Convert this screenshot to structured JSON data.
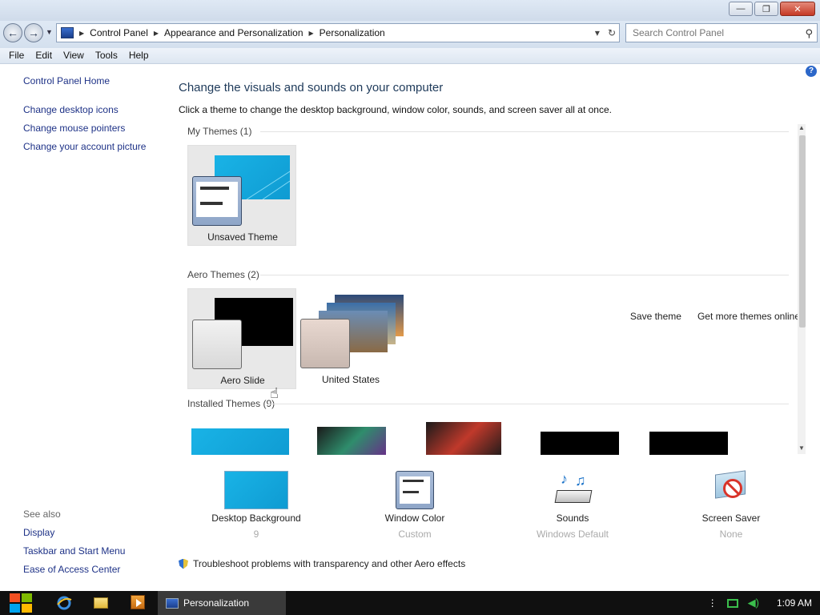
{
  "window": {
    "minimize_glyph": "—",
    "maximize_glyph": "❐",
    "close_glyph": "✕"
  },
  "nav": {
    "back_glyph": "←",
    "forward_glyph": "→",
    "dropdown_glyph": "▼",
    "breadcrumbs": [
      "Control Panel",
      "Appearance and Personalization",
      "Personalization"
    ],
    "refresh_glyph": "↻",
    "addr_dropdown_glyph": "▾",
    "search_placeholder": "Search Control Panel",
    "search_glyph": "⚲"
  },
  "menu": [
    "File",
    "Edit",
    "View",
    "Tools",
    "Help"
  ],
  "sidebar": {
    "home": "Control Panel Home",
    "links": [
      "Change desktop icons",
      "Change mouse pointers",
      "Change your account picture"
    ],
    "see_also": "See also",
    "see_also_links": [
      "Display",
      "Taskbar and Start Menu",
      "Ease of Access Center"
    ]
  },
  "main": {
    "help_glyph": "?",
    "title": "Change the visuals and sounds on your computer",
    "subtitle": "Click a theme to change the desktop background, window color, sounds, and screen saver all at once.",
    "groups": {
      "my_themes": "My Themes (1)",
      "aero_themes": "Aero Themes (2)",
      "installed_themes": "Installed Themes (9)"
    },
    "themes": {
      "unsaved": "Unsaved Theme",
      "aero_slide": "Aero Slide",
      "united_states": "United States"
    },
    "actions": {
      "save": "Save theme",
      "more": "Get more themes online"
    },
    "settings": [
      {
        "label": "Desktop Background",
        "value": "9"
      },
      {
        "label": "Window Color",
        "value": "Custom"
      },
      {
        "label": "Sounds",
        "value": "Windows Default"
      },
      {
        "label": "Screen Saver",
        "value": "None"
      }
    ],
    "troubleshoot": "Troubleshoot problems with transparency and other Aero effects"
  },
  "taskbar": {
    "active_window": "Personalization",
    "time": "1:09 AM",
    "tray_more_glyph": "⋮"
  },
  "colors": {
    "accent_blue": "#1ab4e8",
    "link_blue": "#1e3287",
    "taskbar": "#101010"
  }
}
